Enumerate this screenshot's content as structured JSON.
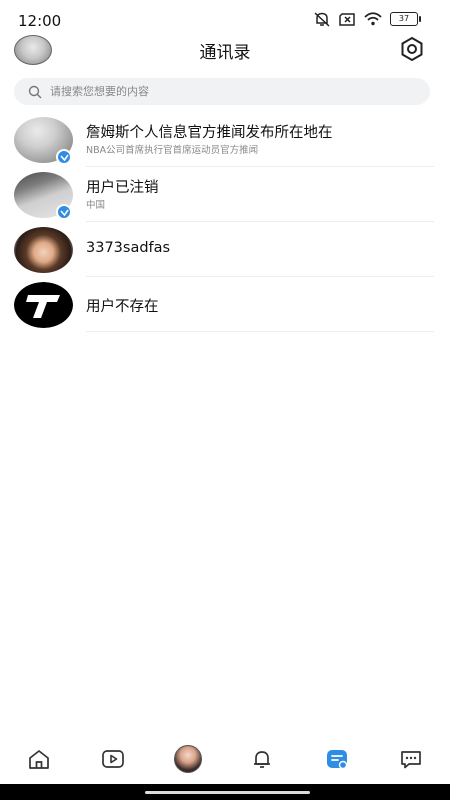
{
  "status_bar": {
    "time": "12:00",
    "battery": "37",
    "icons": [
      "bell-muted-icon",
      "sim-x-icon",
      "wifi-icon",
      "battery-icon"
    ]
  },
  "header": {
    "title": "通讯录",
    "settings_icon": "hexagon-settings-icon"
  },
  "search": {
    "placeholder": "请搜索您想要的内容"
  },
  "contacts": [
    {
      "name": "詹姆斯个人信息官方推闻发布所在地在",
      "subtitle": "NBA公司首席执行官首席运动员官方推闻",
      "verified": true
    },
    {
      "name": "用户已注销",
      "subtitle": "中国",
      "verified": true
    },
    {
      "name": "3373sadfas",
      "subtitle": "",
      "verified": false
    },
    {
      "name": "用户不存在",
      "subtitle": "",
      "verified": false
    }
  ],
  "tabbar": {
    "tabs": [
      "home-icon",
      "video-icon",
      "profile-avatar",
      "bell-icon",
      "contacts-icon",
      "message-icon"
    ],
    "active": "contacts-icon",
    "accent": "#2f8de4"
  }
}
